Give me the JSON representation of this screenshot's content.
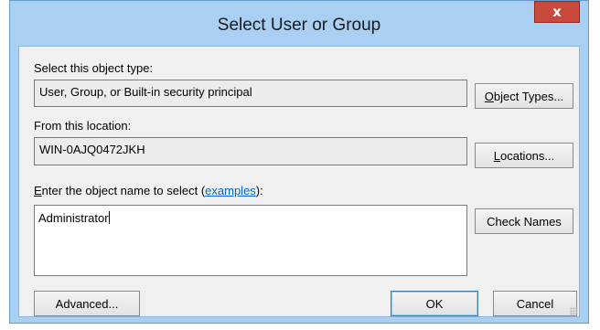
{
  "window": {
    "title": "Select User or Group",
    "close_glyph": "x"
  },
  "object_type": {
    "label": "Select this object type:",
    "value": "User, Group, or Built-in security principal",
    "button_label_first": "O",
    "button_label_rest": "bject Types..."
  },
  "location": {
    "label": "From this location:",
    "value": "WIN-0AJQ0472JKH",
    "button_label_first": "L",
    "button_label_rest": "ocations..."
  },
  "object_name": {
    "label_first": "E",
    "label_rest": "nter the object name to select (",
    "link": "examples",
    "label_end": "):",
    "value": "Administrator"
  },
  "buttons": {
    "check_names": "Check Names",
    "advanced": "Advanced...",
    "ok": "OK",
    "cancel": "Cancel"
  },
  "colors": {
    "titlebar": "#a9d0f2",
    "close": "#c74a3c",
    "client": "#f0f0f0",
    "link": "#0066cc"
  }
}
